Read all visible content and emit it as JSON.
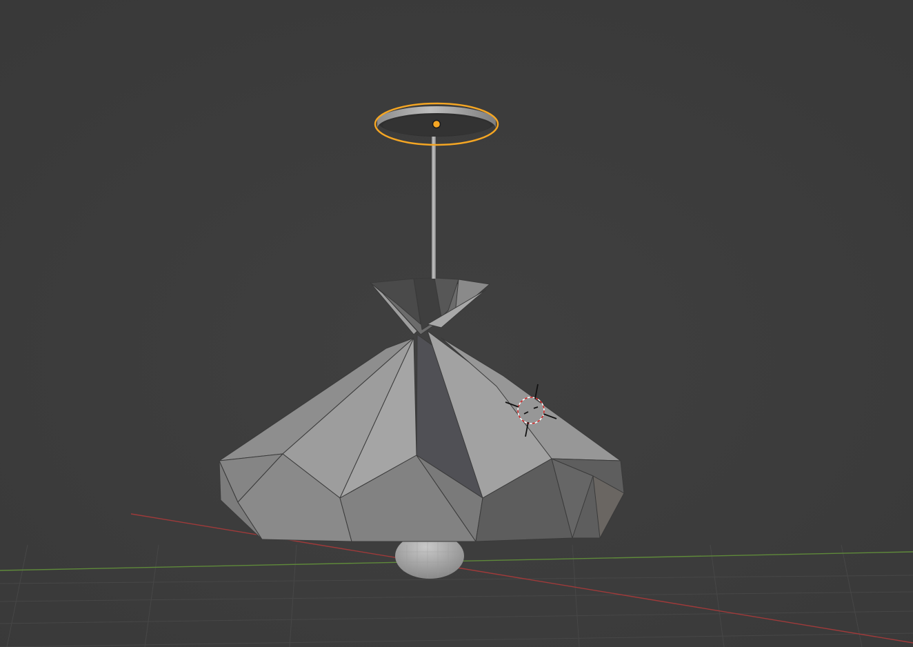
{
  "app": "3D Viewport",
  "viewport": {
    "background": "#3d3d3d",
    "grid_color": "#474747",
    "x_axis_color": "#a03a3a",
    "y_axis_color": "#5f8a3a",
    "selection_color": "#f5a623",
    "origin_color": "#f5a623"
  },
  "scene": {
    "objects": [
      {
        "name": "ceiling-canopy",
        "selected": true
      },
      {
        "name": "suspension-rod",
        "selected": false
      },
      {
        "name": "lamp-shade",
        "selected": false
      },
      {
        "name": "light-bulb",
        "selected": false
      }
    ],
    "cursor": "3d-cursor-icon"
  }
}
